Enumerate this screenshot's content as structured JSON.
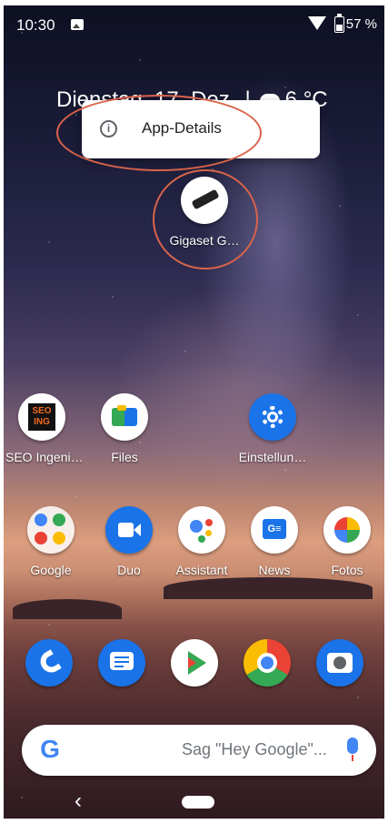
{
  "status_bar": {
    "time": "10:30",
    "battery_percent": "57 %"
  },
  "glance": {
    "date": "Dienstag, 17. Dez.",
    "separator": "|",
    "temperature": "6 °C"
  },
  "popup": {
    "item_label": "App-Details"
  },
  "highlighted_app": {
    "label": "Gigaset G…"
  },
  "home_apps": [
    {
      "label": "SEO Ingeni…"
    },
    {
      "label": "Files"
    },
    {
      "label": "Einstellun…"
    },
    {
      "label": "Google"
    },
    {
      "label": "Duo"
    },
    {
      "label": "Assistant"
    },
    {
      "label": "News"
    },
    {
      "label": "Fotos"
    }
  ],
  "seo_icon_text": [
    "SEO",
    "ING"
  ],
  "search": {
    "hint": "Sag \"Hey Google\"..."
  },
  "colors": {
    "accent_blue": "#1a73e8",
    "annotation": "#d9634a"
  },
  "icons": {
    "phone": "phone-icon",
    "messages": "messages-icon",
    "play_store": "play-store-icon",
    "chrome": "chrome-icon",
    "camera": "camera-icon"
  }
}
